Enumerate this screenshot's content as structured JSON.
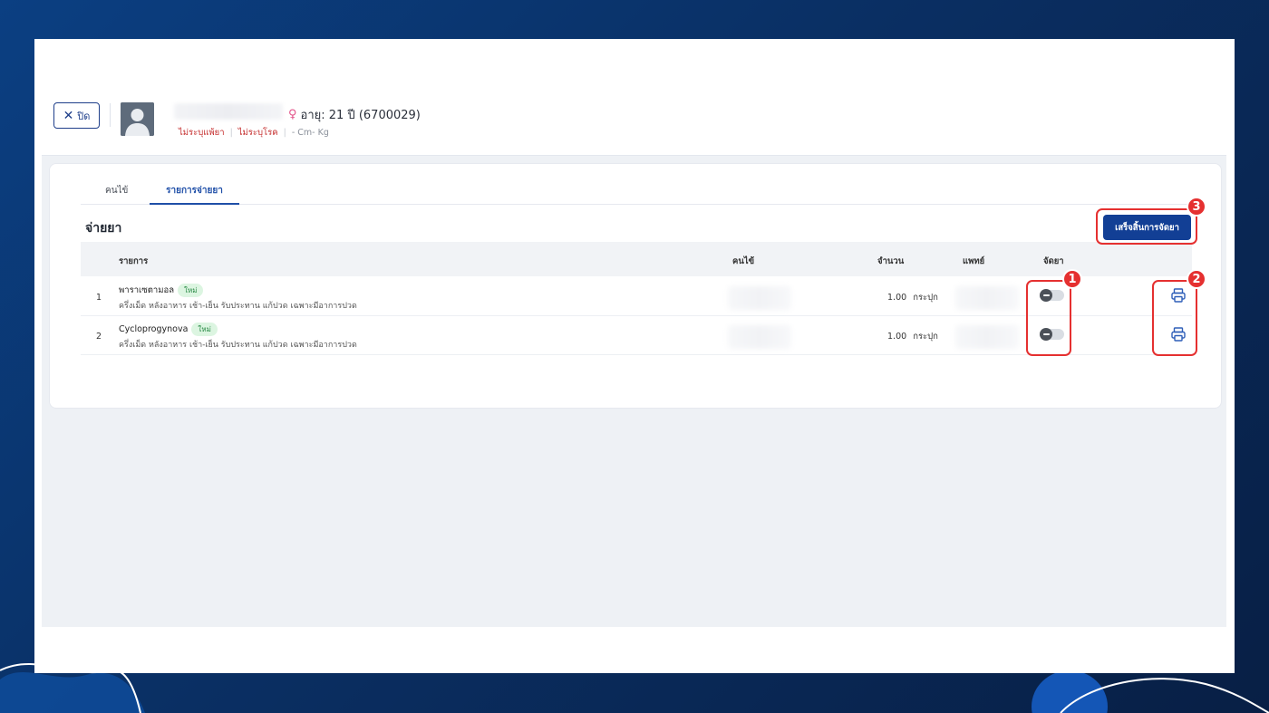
{
  "header": {
    "close_label": "ปิด",
    "patient_info": "อายุ: 21 ปี (6700029)",
    "allergy": "ไม่ระบุแพ้ยา",
    "disease": "ไม่ระบุโรค",
    "body_metrics": "- Cm- Kg"
  },
  "tabs": [
    {
      "label": "คนไข้",
      "active": false
    },
    {
      "label": "รายการจ่ายยา",
      "active": true
    }
  ],
  "section": {
    "title": "จ่ายยา",
    "finish_button": "เสร็จสิ้นการจัดยา"
  },
  "table": {
    "headers": [
      "รายการ",
      "คนไข้",
      "จำนวน",
      "แพทย์",
      "จัดยา"
    ],
    "rows": [
      {
        "index": "1",
        "name": "พาราเซตามอล",
        "badge": "ใหม่",
        "instruction": "ครึ่งเม็ด หลังอาหาร เช้า-เย็น รับประทาน แก้ปวด เฉพาะมีอาการปวด",
        "quantity": "1.00",
        "unit": "กระปุก",
        "dispensed": false
      },
      {
        "index": "2",
        "name": "Cycloprogynova",
        "badge": "ใหม่",
        "instruction": "ครึ่งเม็ด หลังอาหาร เช้า-เย็น รับประทาน แก้ปวด เฉพาะมีอาการปวด",
        "quantity": "1.00",
        "unit": "กระปุก",
        "dispensed": false
      }
    ]
  },
  "annotations": [
    "1",
    "2",
    "3"
  ],
  "colors": {
    "primary": "#123f95",
    "annotation_red": "#e53030",
    "badge_green_bg": "#dcf5e1",
    "background_blue": "#0b3f82"
  }
}
